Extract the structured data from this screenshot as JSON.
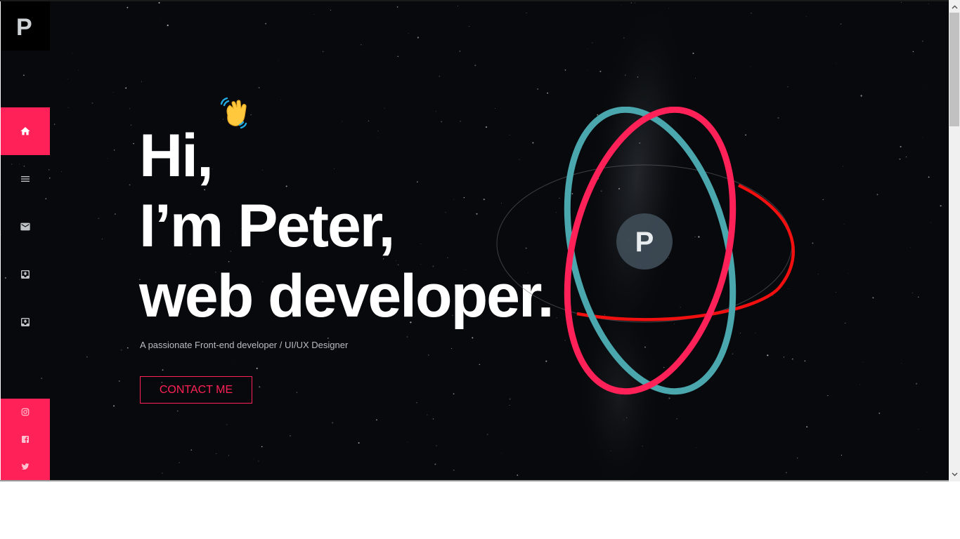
{
  "brand": {
    "logo_letter": "P"
  },
  "sidebar": {
    "nav": [
      {
        "icon": "home-icon",
        "active": true
      },
      {
        "icon": "menu-icon",
        "active": false
      },
      {
        "icon": "mail-icon",
        "active": false
      },
      {
        "icon": "download-box-icon",
        "active": false
      },
      {
        "icon": "download-box-icon",
        "active": false
      }
    ],
    "social": [
      {
        "icon": "instagram-icon"
      },
      {
        "icon": "facebook-icon"
      },
      {
        "icon": "twitter-icon"
      }
    ]
  },
  "hero": {
    "line1": "Hi,",
    "line2": "I’m Peter,",
    "line3": "web developer.",
    "wave_icon": "waving-hand-icon",
    "subtitle": "A passionate Front-end developer / UI/UX Designer",
    "cta": "CONTACT ME"
  },
  "atom": {
    "center_letter": "P"
  },
  "colors": {
    "accent": "#ff2157",
    "teal": "#4aa7ad",
    "orbit_red": "#ff1010",
    "background": "#07090c"
  }
}
